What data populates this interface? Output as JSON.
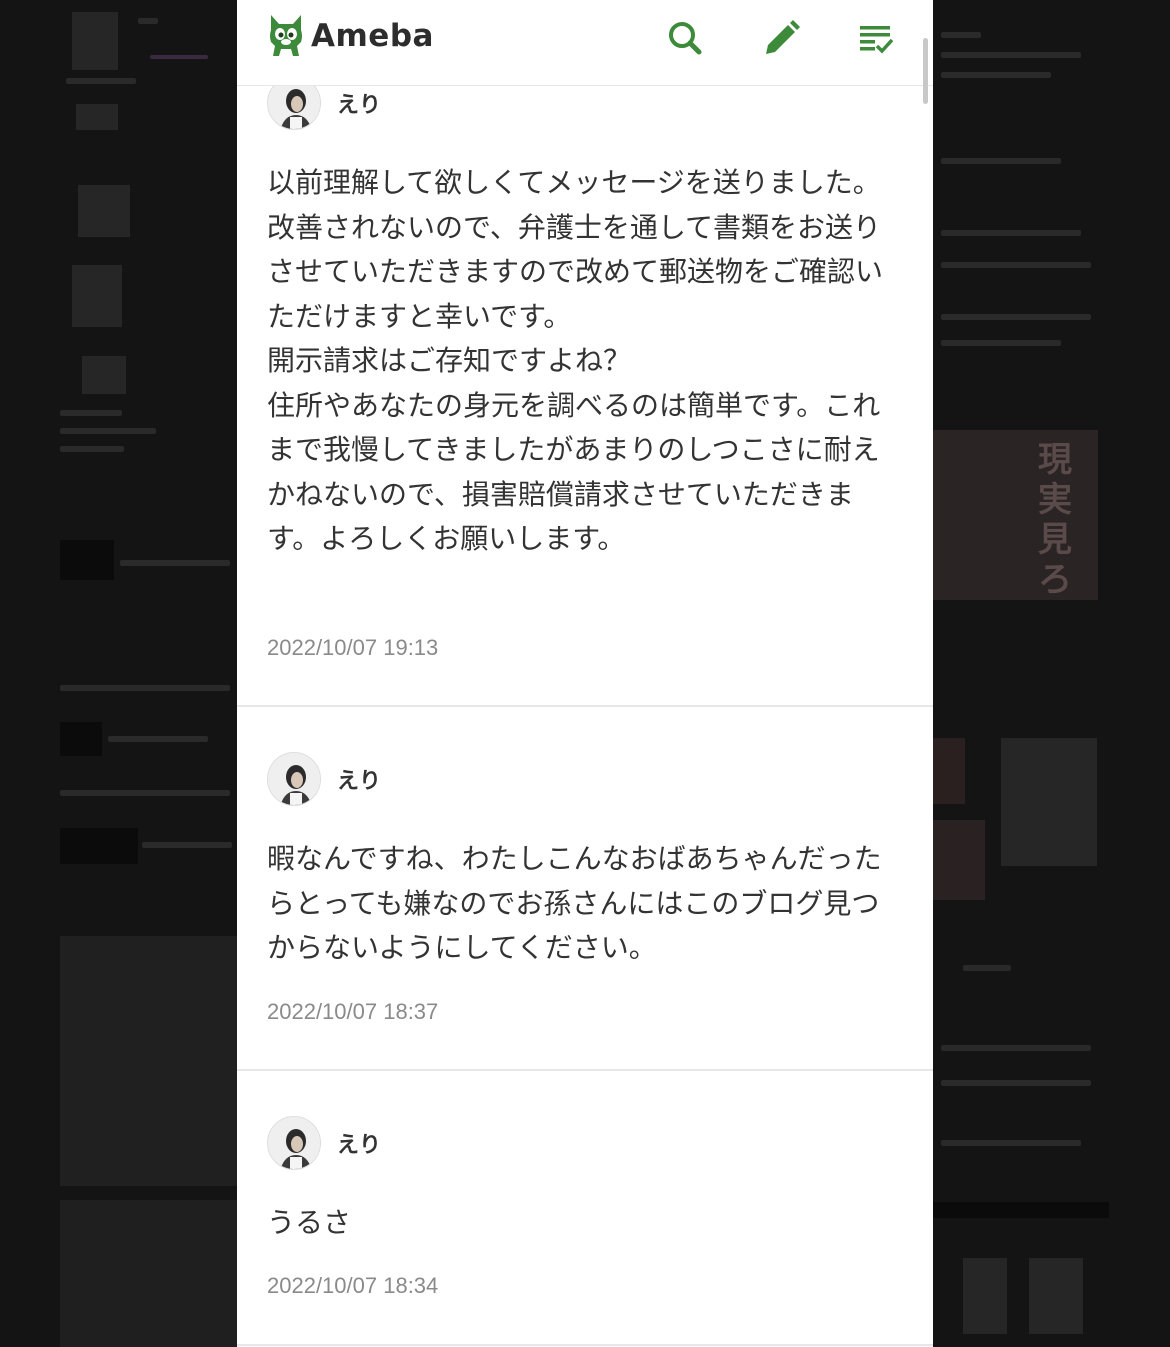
{
  "header": {
    "logo_text": "Ameba",
    "brand_color": "#3d8a3a",
    "icons": [
      "search-icon",
      "pencil-icon",
      "feed-list-icon"
    ]
  },
  "comments": [
    {
      "author": "えり",
      "body": "以前理解して欲しくてメッセージを送りました。\n改善されないので、弁護士を通して書類をお送りさせていただきますので改めて郵送物をご確認いただけますと幸いです。\n開示請求はご存知ですよね？\n住所やあなたの身元を調べるのは簡単です。これまで我慢してきましたがあまりのしつこさに耐えかねないので、損害賠償請求させていただきます。よろしくお願いします。",
      "time": "2022/10/07 19:13"
    },
    {
      "author": "えり",
      "body": "暇なんですね、わたしこんなおばあちゃんだったらとっても嫌なのでお孫さんにはこのブログ見つからないようにしてください。",
      "time": "2022/10/07 18:37"
    },
    {
      "author": "えり",
      "body": "うるさ",
      "time": "2022/10/07 18:34"
    }
  ],
  "background": {
    "poster_text": "現実見ろ"
  }
}
